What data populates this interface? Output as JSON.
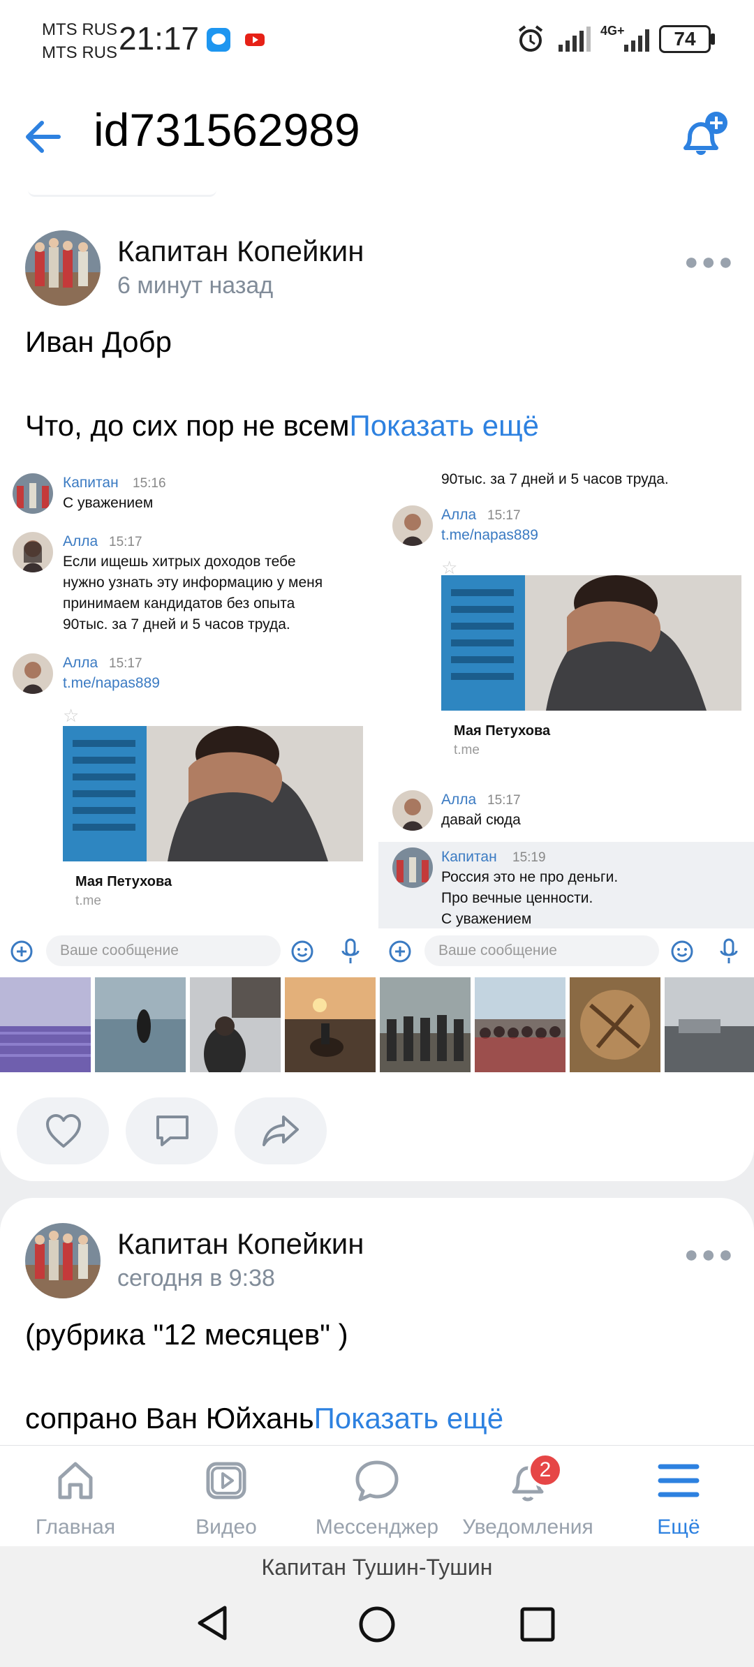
{
  "status_bar": {
    "carrier1": "MTS RUS",
    "carrier2": "MTS RUS",
    "time": "21:17",
    "network": "4G+",
    "battery": "74"
  },
  "header": {
    "title": "id731562989"
  },
  "posts": [
    {
      "author": "Капитан Копейкин",
      "time": "6 минут назад",
      "line1": "Иван Добр",
      "line2": "Что, до сих пор не всем",
      "show_more": "Показать ещё",
      "chat_left": {
        "m1_name": "Капитан",
        "m1_time": "15:16",
        "m1_text": "С уважением",
        "m2_name": "Алла",
        "m2_time": "15:17",
        "m2_text1": "Если ищешь хитрых доходов тебе",
        "m2_text2": "нужно узнать эту информацию у меня",
        "m2_text3": "принимаем кандидатов без опыта",
        "m2_text4": "90тыс. за 7 дней и 5 часов труда.",
        "m3_name": "Алла",
        "m3_time": "15:17",
        "m3_link": "t.me/napas889",
        "card_title": "Мая Петухова",
        "card_sub": "t.me",
        "input_placeholder": "Ваше сообщение"
      },
      "chat_right": {
        "top_text": "90тыс. за 7 дней и 5 часов труда.",
        "m1_name": "Алла",
        "m1_time": "15:17",
        "m1_link": "t.me/napas889",
        "card_title": "Мая Петухова",
        "card_sub": "t.me",
        "m2_name": "Алла",
        "m2_time": "15:17",
        "m2_text": "давай сюда",
        "m3_name": "Капитан",
        "m3_time": "15:19",
        "m3_text1": "Россия это не про деньги.",
        "m3_text2": "Про вечные ценности.",
        "m3_text3": "С уважением",
        "input_placeholder": "Ваше сообщение"
      }
    },
    {
      "author": "Капитан Копейкин",
      "time": "сегодня в 9:38",
      "line1": "(рубрика \"12 месяцев\" )",
      "line2": "сопрано Ван Юйхань",
      "show_more": "Показать ещё"
    }
  ],
  "bottom_nav": {
    "items": [
      {
        "label": "Главная",
        "icon": "home-icon"
      },
      {
        "label": "Видео",
        "icon": "video-icon"
      },
      {
        "label": "Мессенджер",
        "icon": "messenger-icon"
      },
      {
        "label": "Уведомления",
        "icon": "bell-icon",
        "badge": "2"
      },
      {
        "label": "Ещё",
        "icon": "menu-icon"
      }
    ]
  },
  "system_bar": {
    "label": "Капитан Тушин-Тушин"
  },
  "colors": {
    "accent": "#2d81e0",
    "badge": "#e64646",
    "muted": "#818c99"
  }
}
